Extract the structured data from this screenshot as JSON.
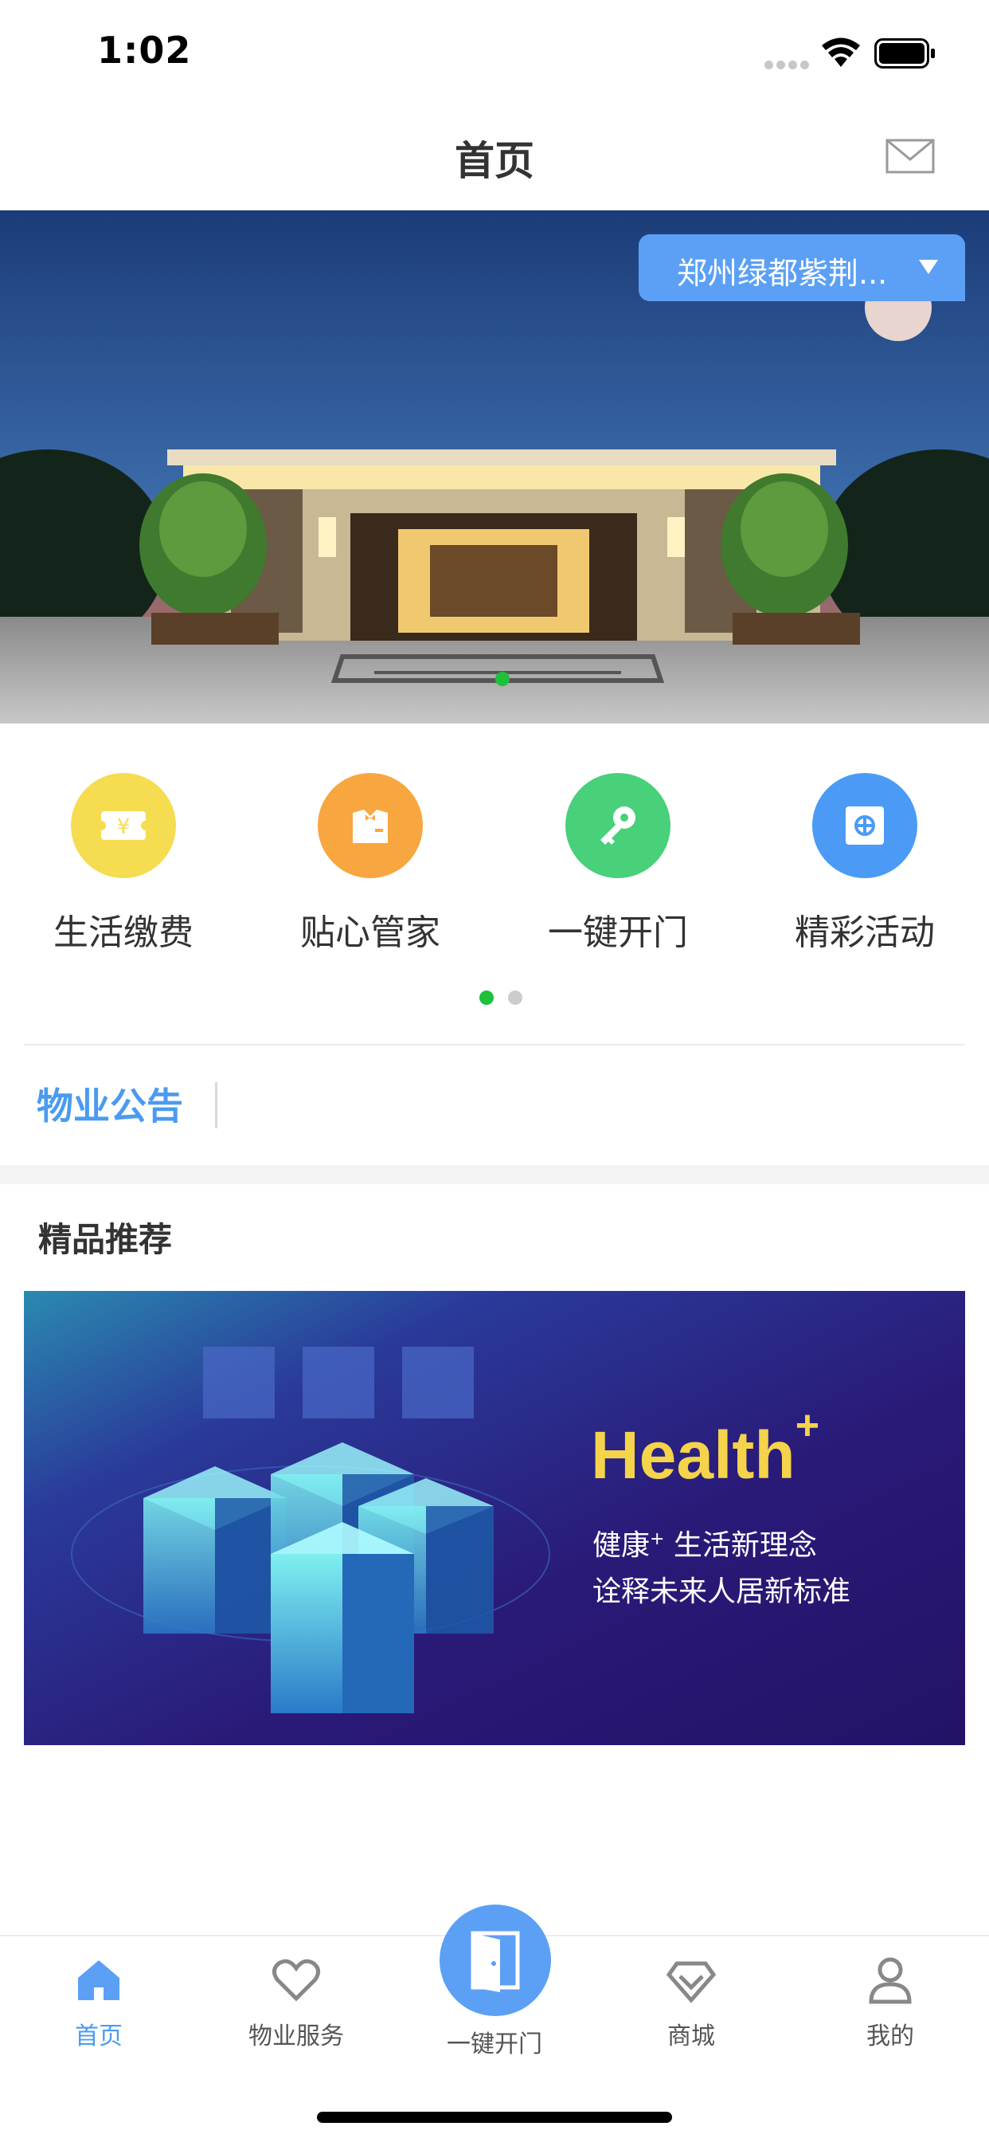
{
  "status_bar": {
    "time": "1:02"
  },
  "nav": {
    "title": "首页",
    "mail_icon": "mail-icon"
  },
  "banner": {
    "location": "郑州绿都紫荆...",
    "active_slide": 1,
    "slide_count": 1
  },
  "quick_services": {
    "items": [
      {
        "label": "生活缴费",
        "icon": "payment-icon",
        "color": "#f5dc50"
      },
      {
        "label": "贴心管家",
        "icon": "butler-icon",
        "color": "#f8a640"
      },
      {
        "label": "一键开门",
        "icon": "key-icon",
        "color": "#48d07a"
      },
      {
        "label": "精彩活动",
        "icon": "activity-icon",
        "color": "#4b9bf6"
      }
    ],
    "active_page": 1,
    "page_count": 2
  },
  "notice": {
    "label": "物业公告"
  },
  "recommend": {
    "title": "精品推荐",
    "promo": {
      "headline": "Health",
      "headline_sup": "+",
      "line1_a": "健康",
      "line1_sup": "+",
      "line1_b": " 生活新理念",
      "line2": "诠释未来人居新标准"
    }
  },
  "tab_bar": {
    "tabs": [
      {
        "label": "首页",
        "icon": "home-icon",
        "active": true
      },
      {
        "label": "物业服务",
        "icon": "heart-icon",
        "active": false
      },
      {
        "label": "商城",
        "icon": "diamond-icon",
        "active": false
      },
      {
        "label": "我的",
        "icon": "user-icon",
        "active": false
      }
    ],
    "center": {
      "label": "一键开门",
      "icon": "door-icon"
    }
  },
  "colors": {
    "accent": "#4a9bf0",
    "active_dot": "#1ec03c",
    "location_bg": "#5ba0f5"
  }
}
